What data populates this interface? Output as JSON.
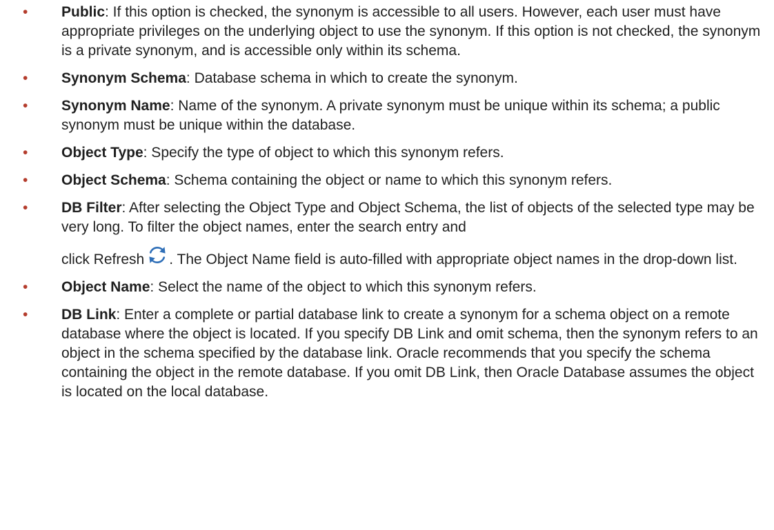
{
  "bullet_char": "•",
  "items": [
    {
      "term": "Public",
      "description": ": If this option is checked, the synonym is accessible to all users. However, each user must have appropriate privileges on the underlying object to use the synonym. If this option is not checked, the synonym is a private synonym, and is accessible only within its schema."
    },
    {
      "term": "Synonym Schema",
      "description": ": Database schema in which to create the synonym."
    },
    {
      "term": "Synonym Name",
      "description": ": Name of the synonym. A private synonym must be unique within its schema; a public synonym must be unique within the database."
    },
    {
      "term": "Object Type",
      "description": ": Specify the type of object to which this synonym refers."
    },
    {
      "term": "Object Schema",
      "description": ": Schema containing the object or name to which this synonym refers."
    },
    {
      "term": "DB Filter",
      "description": ": After selecting the Object Type and Object Schema, the list of objects of the selected type may be very long. To filter the object names, enter the search entry and",
      "description_cont_before_icon": "click Refresh",
      "icon": "refresh-icon",
      "description_cont_after_icon": ". The Object Name field is auto-filled with appropriate object names in the drop-down list."
    },
    {
      "term": "Object Name",
      "description": ": Select the name of the object to which this synonym refers."
    },
    {
      "term": "DB Link",
      "description": ": Enter a complete or partial database link to create a synonym for a schema object on a remote database where the object is located. If you specify DB Link and omit schema, then the synonym refers to an object in the schema specified by the database link. Oracle recommends that you specify the schema containing the object in the remote database. If you omit DB Link, then Oracle Database assumes the object is located on the local database."
    }
  ],
  "colors": {
    "bullet": "#b43c2c",
    "text": "#1f1f1f",
    "icon": "#2f6fb8"
  }
}
